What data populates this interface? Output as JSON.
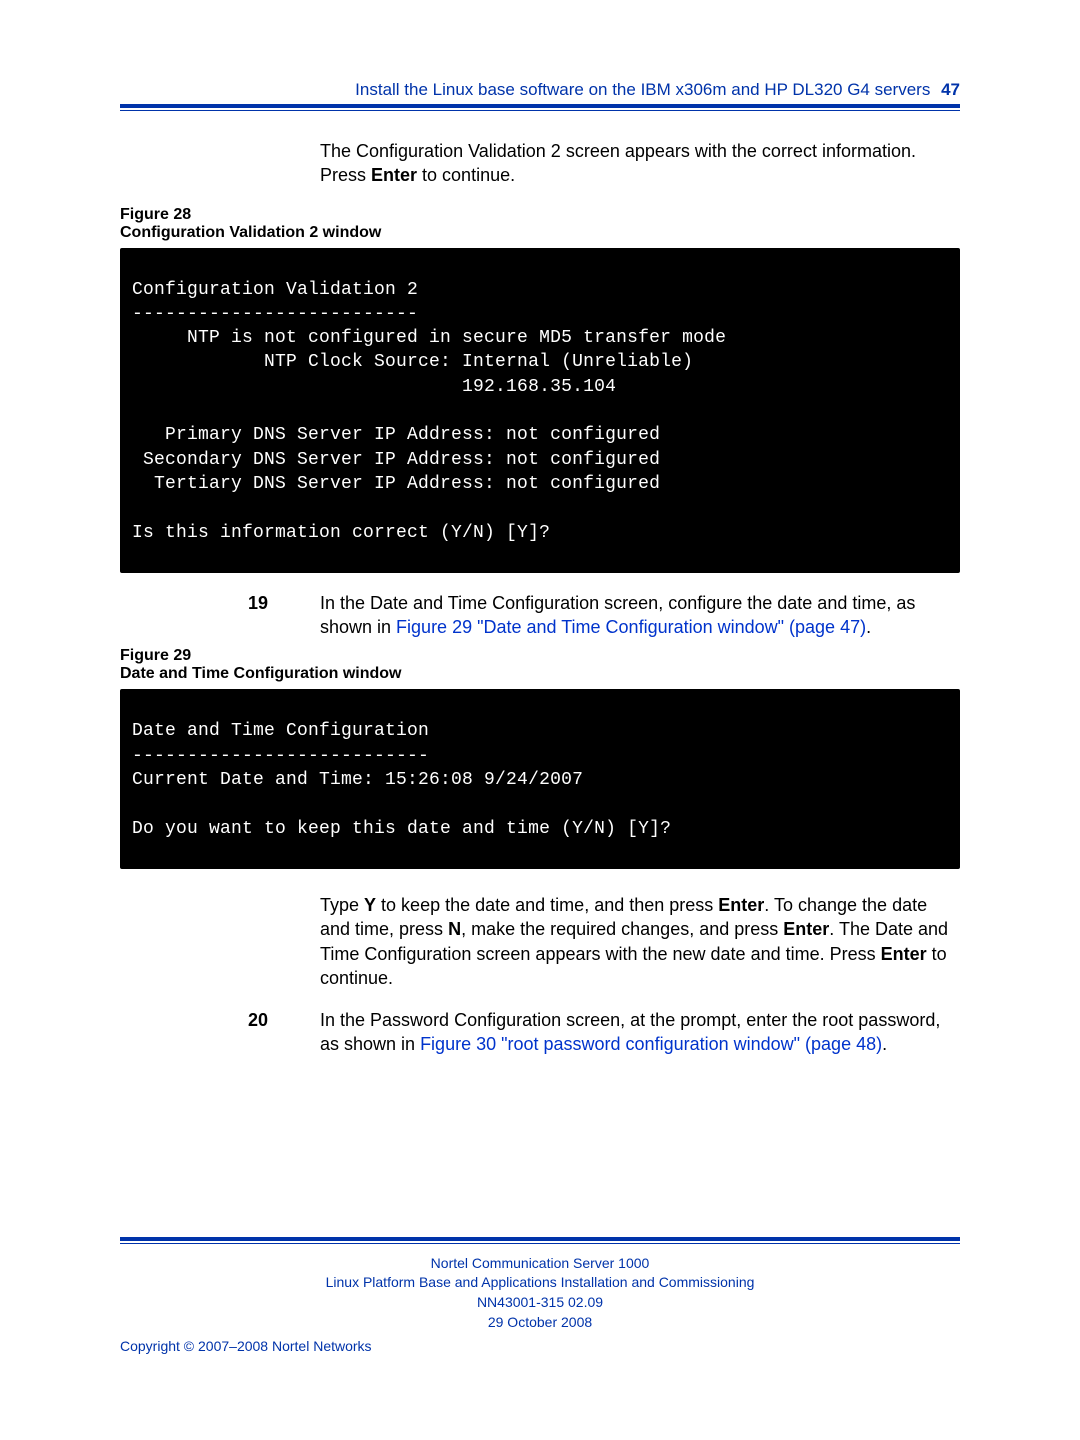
{
  "header": {
    "title": "Install the Linux base software on the IBM x306m and HP DL320 G4 servers",
    "page_number": "47"
  },
  "intro": {
    "p1a": "The Configuration Validation 2 screen appears with the correct information. Press ",
    "p1b": "Enter",
    "p1c": " to continue."
  },
  "fig28": {
    "label_line1": "Figure 28",
    "label_line2": "Configuration Validation 2 window",
    "terminal": "Configuration Validation 2\n--------------------------\n     NTP is not configured in secure MD5 transfer mode\n            NTP Clock Source: Internal (Unreliable)\n                              192.168.35.104\n\n   Primary DNS Server IP Address: not configured\n Secondary DNS Server IP Address: not configured\n  Tertiary DNS Server IP Address: not configured\n\nIs this information correct (Y/N) [Y]?"
  },
  "step19": {
    "num": "19",
    "a": "In the Date and Time Configuration screen, configure the date and time, as shown in ",
    "link": "Figure 29 \"Date and Time Configuration window\" (page 47)",
    "b": "."
  },
  "fig29": {
    "label_line1": "Figure 29",
    "label_line2": "Date and Time Configuration window",
    "terminal": "Date and Time Configuration\n---------------------------\nCurrent Date and Time: 15:26:08 9/24/2007\n\nDo you want to keep this date and time (Y/N) [Y]?"
  },
  "after29": {
    "a": "Type ",
    "Y": "Y",
    "b": " to keep the date and time, and then press ",
    "Enter1": "Enter",
    "c": ". To change the date and time, press ",
    "N": "N",
    "d": ", make the required changes, and press ",
    "Enter2": "Enter",
    "e": ". The Date and Time Configuration screen appears with the new date and time. Press ",
    "Enter3": "Enter",
    "f": " to continue."
  },
  "step20": {
    "num": "20",
    "a": "In the Password Configuration screen, at the prompt, enter the root password, as shown in ",
    "link": "Figure 30 \"root password configuration window\" (page 48)",
    "b": "."
  },
  "footer": {
    "l1": "Nortel Communication Server 1000",
    "l2": "Linux Platform Base and Applications Installation and Commissioning",
    "l3": "NN43001-315   02.09",
    "l4": "29 October 2008",
    "copyright": "Copyright © 2007–2008 Nortel Networks"
  }
}
